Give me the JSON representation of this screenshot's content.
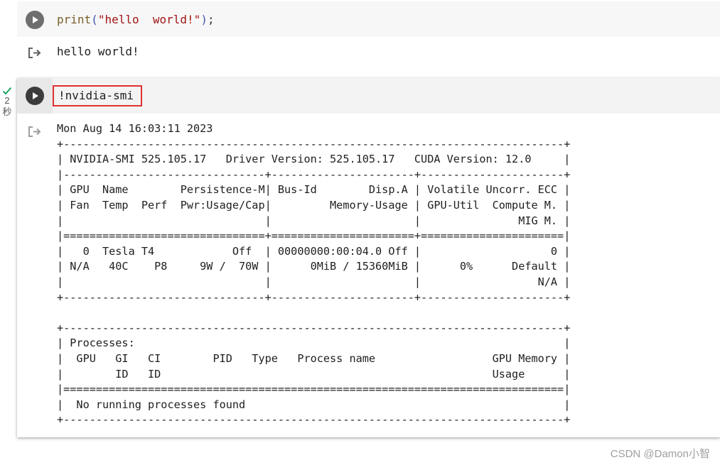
{
  "cell1": {
    "code_kw": "print",
    "code_paren_open": "(",
    "code_string": "\"hello  world!\"",
    "code_paren_close": ")",
    "code_semicolon": ";",
    "output": "hello world!"
  },
  "cell2": {
    "code": "!nvidia-smi",
    "status_time": "2",
    "status_unit": "秒",
    "output_lines": [
      "Mon Aug 14 16:03:11 2023",
      "+-----------------------------------------------------------------------------+",
      "| NVIDIA-SMI 525.105.17   Driver Version: 525.105.17   CUDA Version: 12.0     |",
      "|-------------------------------+----------------------+----------------------+",
      "| GPU  Name        Persistence-M| Bus-Id        Disp.A | Volatile Uncorr. ECC |",
      "| Fan  Temp  Perf  Pwr:Usage/Cap|         Memory-Usage | GPU-Util  Compute M. |",
      "|                               |                      |               MIG M. |",
      "|===============================+======================+======================|",
      "|   0  Tesla T4            Off  | 00000000:00:04.0 Off |                    0 |",
      "| N/A   40C    P8     9W /  70W |      0MiB / 15360MiB |      0%      Default |",
      "|                               |                      |                  N/A |",
      "+-------------------------------+----------------------+----------------------+",
      "",
      "+-----------------------------------------------------------------------------+",
      "| Processes:                                                                  |",
      "|  GPU   GI   CI        PID   Type   Process name                  GPU Memory |",
      "|        ID   ID                                                   Usage      |",
      "|=============================================================================|",
      "|  No running processes found                                                 |",
      "+-----------------------------------------------------------------------------+"
    ]
  },
  "icons": {
    "run": "play-icon",
    "output": "output-arrow-icon",
    "status": "check-icon"
  },
  "colors": {
    "run_button_idle": "#6e6e6e",
    "run_button_active": "#3c3c3c",
    "highlight_box": "#e03131",
    "success_check": "#0f9d58"
  },
  "watermark": "CSDN @Damon小智"
}
